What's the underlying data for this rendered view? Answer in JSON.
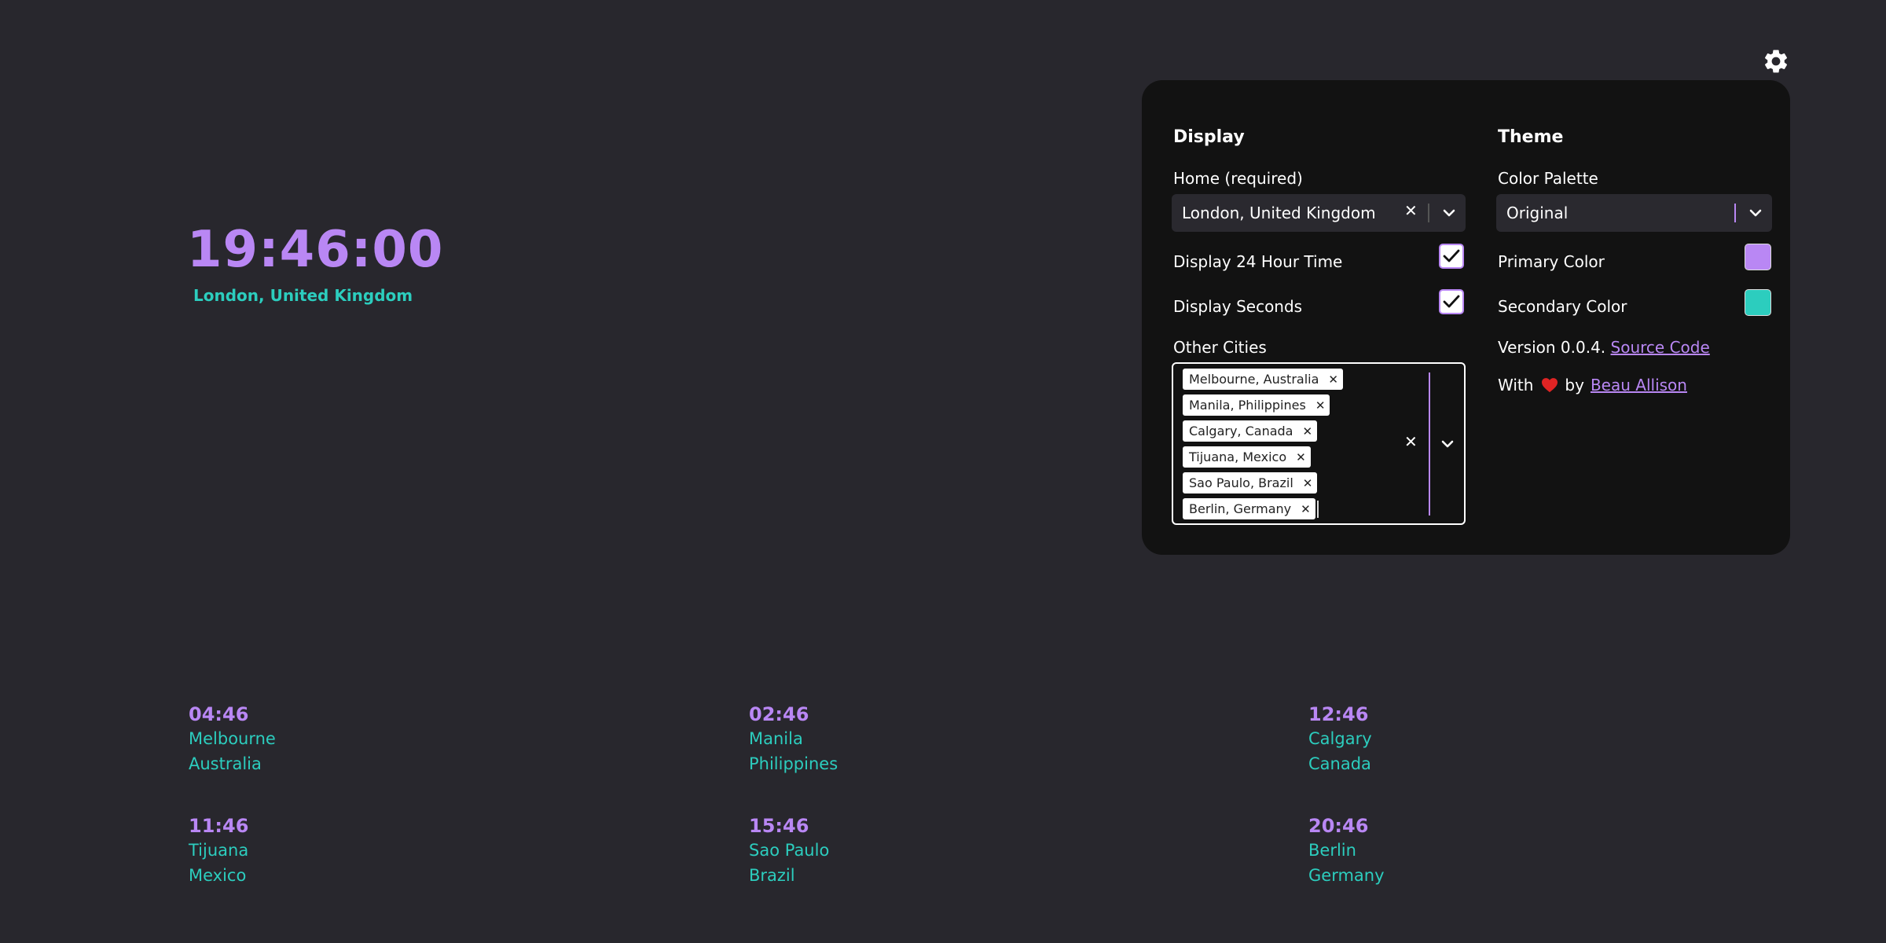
{
  "colors": {
    "primary": "#b987f4",
    "secondary": "#2ccdbe",
    "background": "#28272d",
    "panel": "#121212",
    "heart": "#e02424"
  },
  "settings_icon": "gear-icon",
  "home_clock": {
    "time": "19:46:00",
    "city": "London, United Kingdom"
  },
  "display": {
    "title": "Display",
    "home_label": "Home (required)",
    "home_value": "London, United Kingdom",
    "clear_icon": "close-icon",
    "dropdown_icon": "chevron-down-icon",
    "hour24_label": "Display 24 Hour Time",
    "hour24_checked": true,
    "seconds_label": "Display Seconds",
    "seconds_checked": true,
    "other_cities_label": "Other Cities",
    "other_cities": [
      "Melbourne, Australia",
      "Manila, Philippines",
      "Calgary, Canada",
      "Tijuana, Mexico",
      "Sao Paulo, Brazil",
      "Berlin, Germany"
    ]
  },
  "theme": {
    "title": "Theme",
    "palette_label": "Color Palette",
    "palette_value": "Original",
    "primary_label": "Primary Color",
    "secondary_label": "Secondary Color",
    "version_text": "Version 0.0.4.",
    "source_link": "Source Code",
    "credit_with": "With",
    "credit_by": "by",
    "author_link": "Beau Allison",
    "heart_icon": "heart-icon"
  },
  "city_clocks": [
    {
      "time": "04:46",
      "city": "Melbourne",
      "country": "Australia"
    },
    {
      "time": "02:46",
      "city": "Manila",
      "country": "Philippines"
    },
    {
      "time": "12:46",
      "city": "Calgary",
      "country": "Canada"
    },
    {
      "time": "11:46",
      "city": "Tijuana",
      "country": "Mexico"
    },
    {
      "time": "15:46",
      "city": "Sao Paulo",
      "country": "Brazil"
    },
    {
      "time": "20:46",
      "city": "Berlin",
      "country": "Germany"
    }
  ]
}
